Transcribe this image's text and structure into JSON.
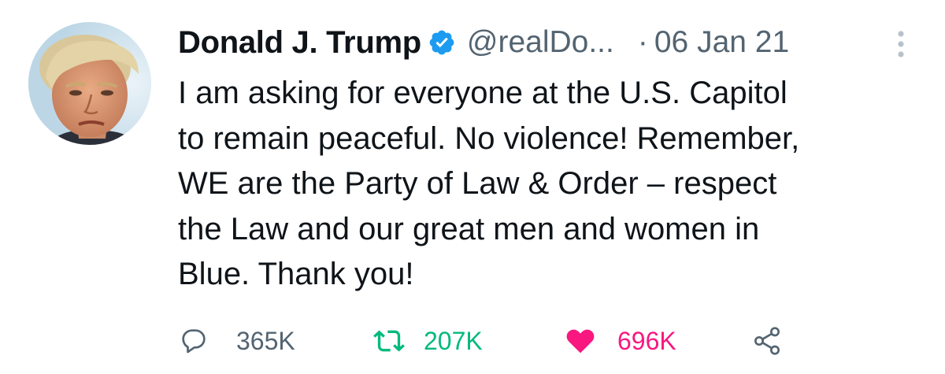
{
  "tweet": {
    "author": {
      "name": "Donald J. Trump",
      "handle": "@realDo...",
      "verified": true,
      "avatar": "profile-photo"
    },
    "separator": "·",
    "date": "06 Jan 21",
    "text_lines": [
      "I am asking for everyone at the U.S. Capitol",
      "to remain peaceful. No violence! Remember,",
      "WE are the Party of Law & Order – respect",
      "the Law and our great men and women in",
      "Blue. Thank you!"
    ],
    "actions": {
      "reply": {
        "icon": "reply-icon",
        "count": "365K"
      },
      "retweet": {
        "icon": "retweet-icon",
        "count": "207K",
        "active": true
      },
      "like": {
        "icon": "heart-icon",
        "count": "696K",
        "active": true
      },
      "share": {
        "icon": "share-icon"
      }
    }
  },
  "colors": {
    "text": "#0f1419",
    "secondary": "#536471",
    "verified_blue": "#1d9bf0",
    "retweet_green": "#00ba7c",
    "like_pink": "#f91880"
  }
}
